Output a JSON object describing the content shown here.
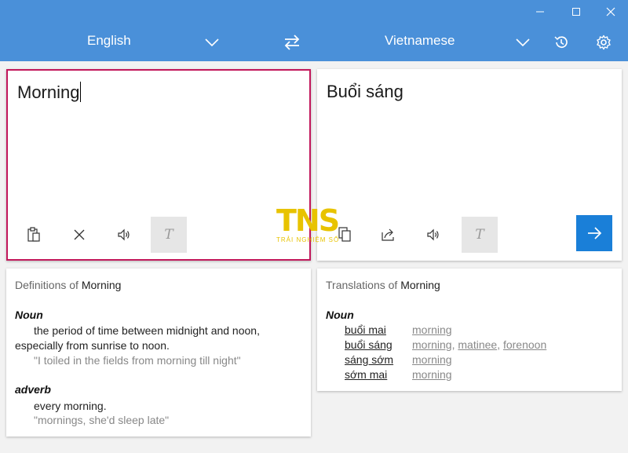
{
  "header": {
    "source_lang": "English",
    "target_lang": "Vietnamese",
    "accent_color": "#4a90d9"
  },
  "input": {
    "text": "Morning"
  },
  "output": {
    "text": "Buổi sáng"
  },
  "toolbar": {
    "format_letter": "T"
  },
  "definitions": {
    "title_prefix": "Definitions of ",
    "word": "Morning",
    "entries": [
      {
        "pos": "Noun",
        "line1": "the period of time between midnight and noon,",
        "line2": "especially from sunrise to noon.",
        "example": "\"I toiled in the fields from morning till night\""
      },
      {
        "pos": "adverb",
        "line1": "every morning.",
        "example": "\"mornings, she'd sleep late\""
      }
    ]
  },
  "translations": {
    "title_prefix": "Translations of ",
    "word": "Morning",
    "pos": "Noun",
    "rows": [
      {
        "word": "buổi mai",
        "back": [
          "morning"
        ]
      },
      {
        "word": "buổi sáng",
        "back": [
          "morning",
          "matinee",
          "forenoon"
        ]
      },
      {
        "word": "sáng sớm",
        "back": [
          "morning"
        ]
      },
      {
        "word": "sớm mai",
        "back": [
          "morning"
        ]
      }
    ]
  },
  "watermark": {
    "logo": "TNS",
    "tagline": "TRẢI NGHIỆM SỐ"
  }
}
